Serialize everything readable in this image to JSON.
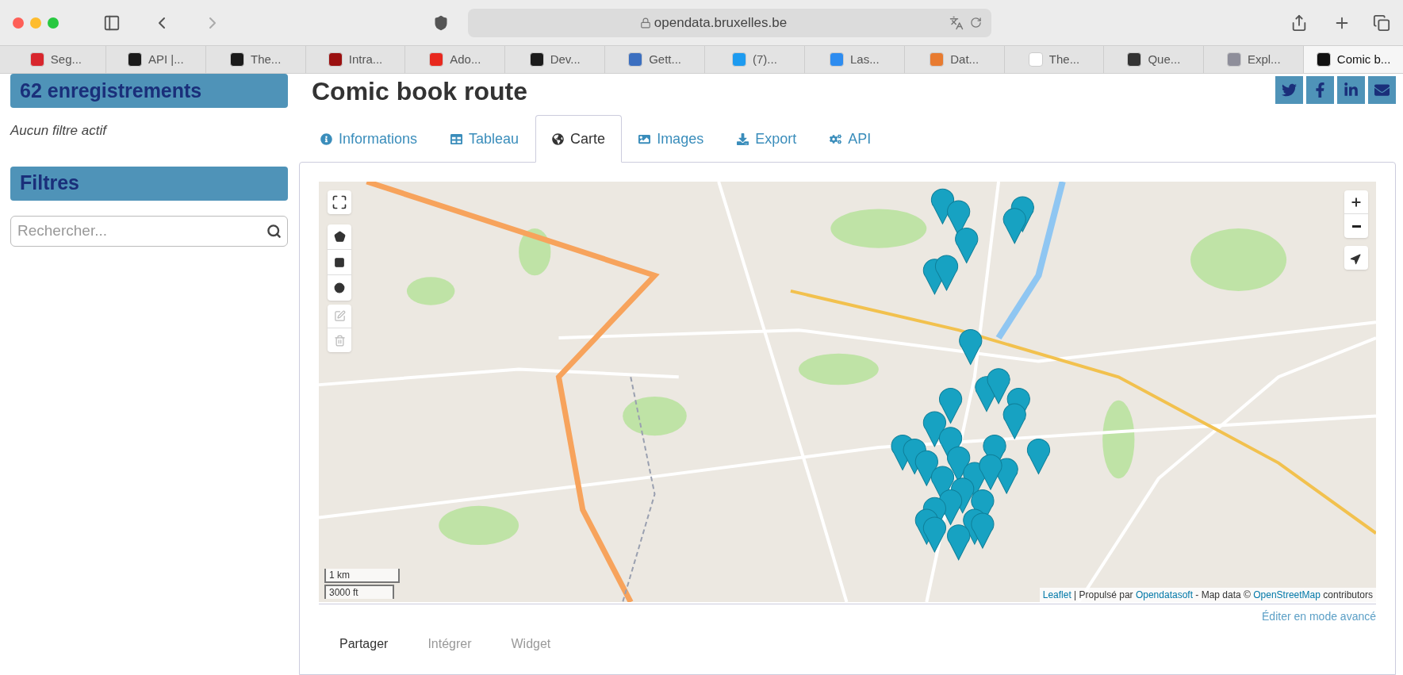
{
  "browser": {
    "address": "opendata.bruxelles.be",
    "tabs": [
      {
        "label": "Seg...",
        "selected": false
      },
      {
        "label": "API |...",
        "selected": false
      },
      {
        "label": "The...",
        "selected": false
      },
      {
        "label": "Intra...",
        "selected": false
      },
      {
        "label": "Ado...",
        "selected": false
      },
      {
        "label": "Dev...",
        "selected": false
      },
      {
        "label": "Gett...",
        "selected": false
      },
      {
        "label": "(7)...",
        "selected": false
      },
      {
        "label": "Las...",
        "selected": false
      },
      {
        "label": "Dat...",
        "selected": false
      },
      {
        "label": "The...",
        "selected": false
      },
      {
        "label": "Que...",
        "selected": false
      },
      {
        "label": "Expl...",
        "selected": false
      },
      {
        "label": "Comic b...",
        "selected": true
      }
    ]
  },
  "sidebar": {
    "count_heading": "62 enregistrements",
    "filter_status": "Aucun filtre actif",
    "filters_heading": "Filtres",
    "search": {
      "placeholder": "Rechercher..."
    }
  },
  "page": {
    "title": "Comic book route",
    "share_buttons": [
      {
        "kind": "twitter"
      },
      {
        "kind": "facebook"
      },
      {
        "kind": "linkedin"
      },
      {
        "kind": "email"
      }
    ],
    "tabs": [
      {
        "label": "Informations",
        "kind": "info",
        "selected": false
      },
      {
        "label": "Tableau",
        "kind": "table",
        "selected": false
      },
      {
        "label": "Carte",
        "kind": "map",
        "selected": true
      },
      {
        "label": "Images",
        "kind": "images",
        "selected": false
      },
      {
        "label": "Export",
        "kind": "export",
        "selected": false
      },
      {
        "label": "API",
        "kind": "api",
        "selected": false
      }
    ],
    "map": {
      "scale": [
        "1 km",
        "3000 ft"
      ],
      "attribution": [
        {
          "text": "Leaflet",
          "kind": "link"
        },
        {
          "text": "| Propulsé par",
          "kind": "text"
        },
        {
          "text": "Opendatasoft",
          "kind": "link"
        },
        {
          "text": "- Map data ©",
          "kind": "text"
        },
        {
          "text": "OpenStreetMap",
          "kind": "link"
        },
        {
          "text": "contributors",
          "kind": "text"
        }
      ]
    },
    "advanced_link": "Éditer en mode avancé",
    "share_tabs": [
      {
        "label": "Partager",
        "selected": true
      },
      {
        "label": "Intégrer",
        "selected": false
      },
      {
        "label": "Widget",
        "selected": false
      }
    ]
  }
}
